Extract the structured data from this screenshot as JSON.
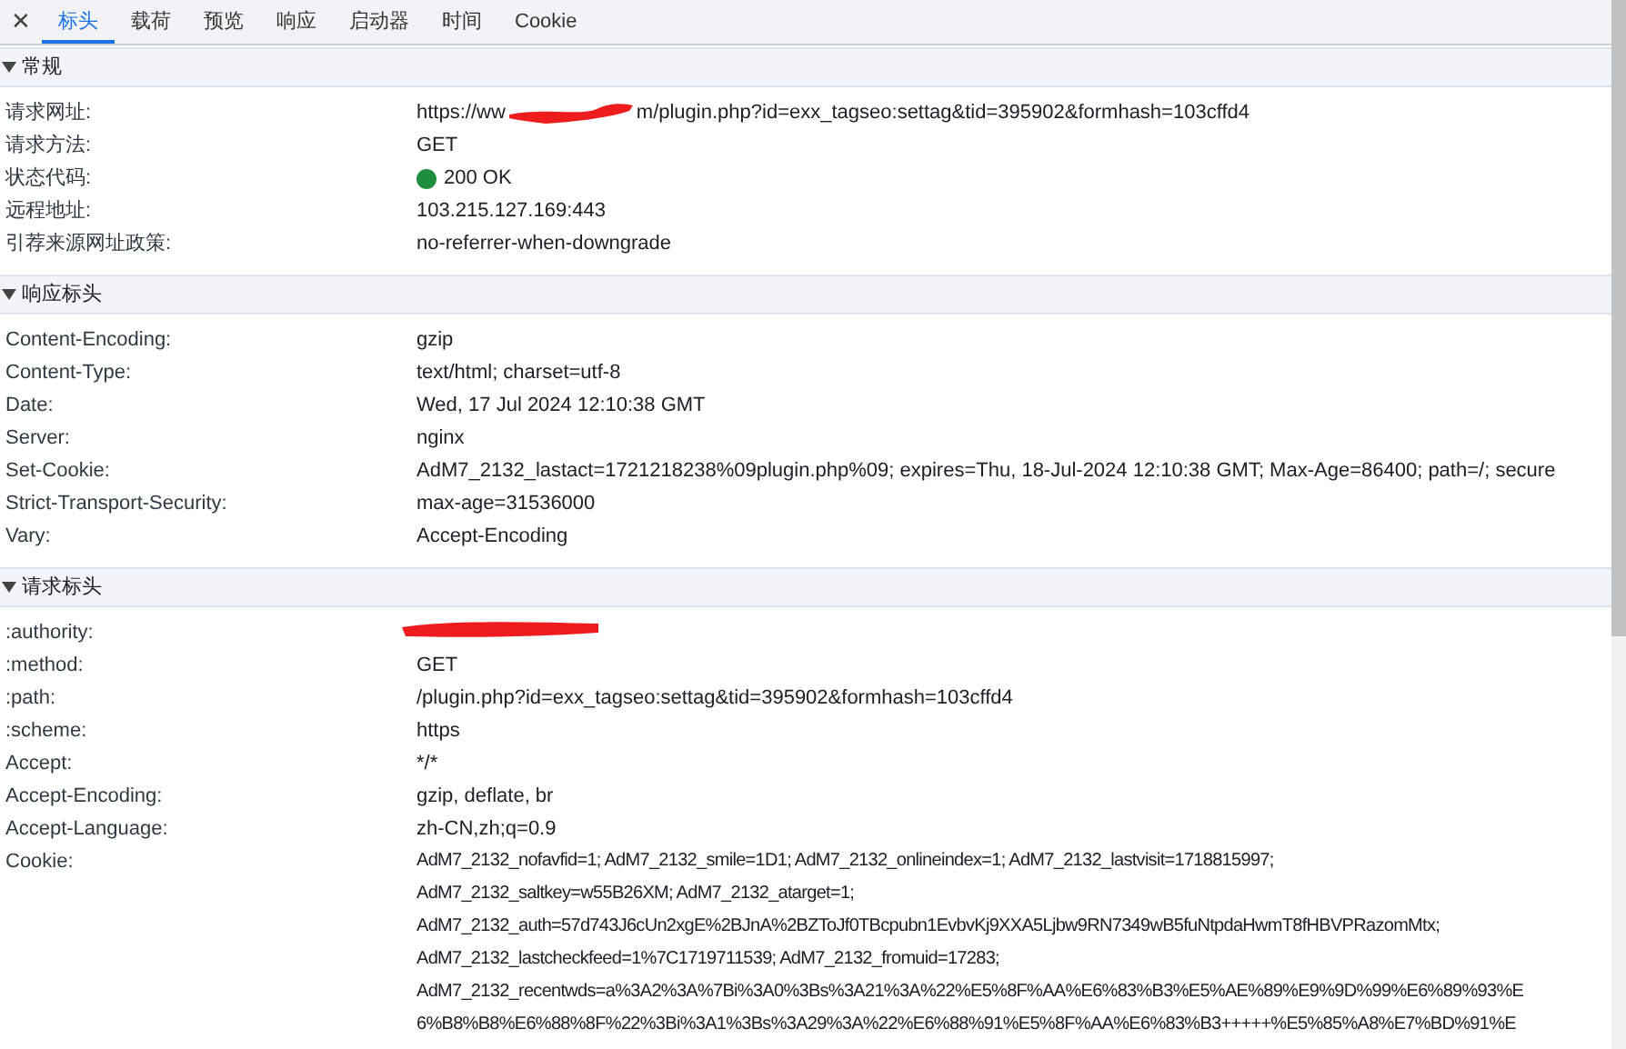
{
  "close_label": "✕",
  "tabs": [
    {
      "label": "标头",
      "selected": true
    },
    {
      "label": "载荷",
      "selected": false
    },
    {
      "label": "预览",
      "selected": false
    },
    {
      "label": "响应",
      "selected": false
    },
    {
      "label": "启动器",
      "selected": false
    },
    {
      "label": "时间",
      "selected": false
    },
    {
      "label": "Cookie",
      "selected": false
    }
  ],
  "sections": [
    {
      "title": "常规",
      "expanded": true,
      "rows": [
        {
          "name": "请求网址:",
          "value_parts": [
            "https://ww",
            "m/plugin.php?id=exx_tagseo:settag&tid=395902&formhash=103cffd4"
          ],
          "redacted": true
        },
        {
          "name": "请求方法:",
          "value_parts": [
            "GET"
          ]
        },
        {
          "name": "状态代码:",
          "value_parts": [
            "200 OK"
          ],
          "color": "#1e8e3e"
        },
        {
          "name": "远程地址:",
          "value_parts": [
            "103.215.127.169:443"
          ]
        },
        {
          "name": "引荐来源网址政策:",
          "value_parts": [
            "no-referrer-when-downgrade"
          ]
        }
      ]
    },
    {
      "title": "响应标头",
      "expanded": true,
      "rows": [
        {
          "name": "Content-Encoding:",
          "value_parts": [
            "gzip"
          ]
        },
        {
          "name": "Content-Type:",
          "value_parts": [
            "text/html; charset=utf-8"
          ]
        },
        {
          "name": "Date:",
          "value_parts": [
            "Wed, 17 Jul 2024 12:10:38 GMT"
          ]
        },
        {
          "name": "Server:",
          "value_parts": [
            "nginx"
          ]
        },
        {
          "name": "Set-Cookie:",
          "value_parts": [
            "AdM7_2132_lastact=1721218238%09plugin.php%09; expires=Thu, 18-Jul-2024 12:10:38 GMT; Max-Age=86400; path=/; secure"
          ]
        },
        {
          "name": "Strict-Transport-Security:",
          "value_parts": [
            "max-age=31536000"
          ]
        },
        {
          "name": "Vary:",
          "value_parts": [
            "Accept-Encoding"
          ]
        }
      ]
    },
    {
      "title": "请求标头",
      "expanded": true,
      "rows": [
        {
          "name": ":authority:",
          "redacted": true
        },
        {
          "name": ":method:",
          "value_parts": [
            "GET"
          ]
        },
        {
          "name": ":path:",
          "value_parts": [
            "/plugin.php?id=exx_tagseo:settag&tid=395902&formhash=103cffd4"
          ]
        },
        {
          "name": ":scheme:",
          "value_parts": [
            "https"
          ]
        },
        {
          "name": "Accept:",
          "value_parts": [
            "*/*"
          ]
        },
        {
          "name": "Accept-Encoding:",
          "value_parts": [
            "gzip, deflate, br"
          ]
        },
        {
          "name": "Accept-Language:",
          "value_parts": [
            "zh-CN,zh;q=0.9"
          ]
        },
        {
          "name": "Cookie:",
          "value_lines": [
            "AdM7_2132_nofavfid=1; AdM7_2132_smile=1D1; AdM7_2132_onlineindex=1; AdM7_2132_lastvisit=1718815997;",
            "AdM7_2132_saltkey=w55B26XM; AdM7_2132_atarget=1;",
            "AdM7_2132_auth=57d743J6cUn2xgE%2BJnA%2BZToJf0TBcpubn1EvbvKj9XXA5Ljbw9RN7349wB5fuNtpdaHwmT8fHBVPRazomMtx;",
            "AdM7_2132_lastcheckfeed=1%7C1719711539; AdM7_2132_fromuid=17283;",
            "AdM7_2132_recentwds=a%3A2%3A%7Bi%3A0%3Bs%3A21%3A%22%E5%8F%AA%E6%83%B3%E5%AE%89%E9%9D%99%E6%89%93%E",
            "6%B8%B8%E6%88%8F%22%3Bi%3A1%3Bs%3A29%3A%22%E6%88%91%E5%8F%AA%E6%83%B3+++++%E5%85%A8%E7%BD%91%E"
          ]
        }
      ]
    }
  ]
}
